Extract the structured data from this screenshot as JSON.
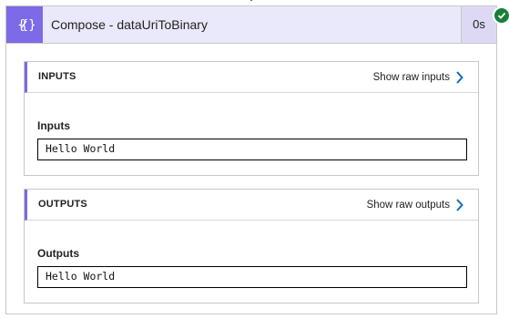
{
  "action": {
    "title": "Compose - dataUriToBinary",
    "duration": "0s",
    "status": "succeeded",
    "icon": "compose-icon",
    "accent_color": "#7d6ae6",
    "success_color": "#188038"
  },
  "inputs": {
    "heading": "INPUTS",
    "raw_link": "Show raw inputs",
    "field_label": "Inputs",
    "value": "Hello World"
  },
  "outputs": {
    "heading": "OUTPUTS",
    "raw_link": "Show raw outputs",
    "field_label": "Outputs",
    "value": "Hello World"
  }
}
